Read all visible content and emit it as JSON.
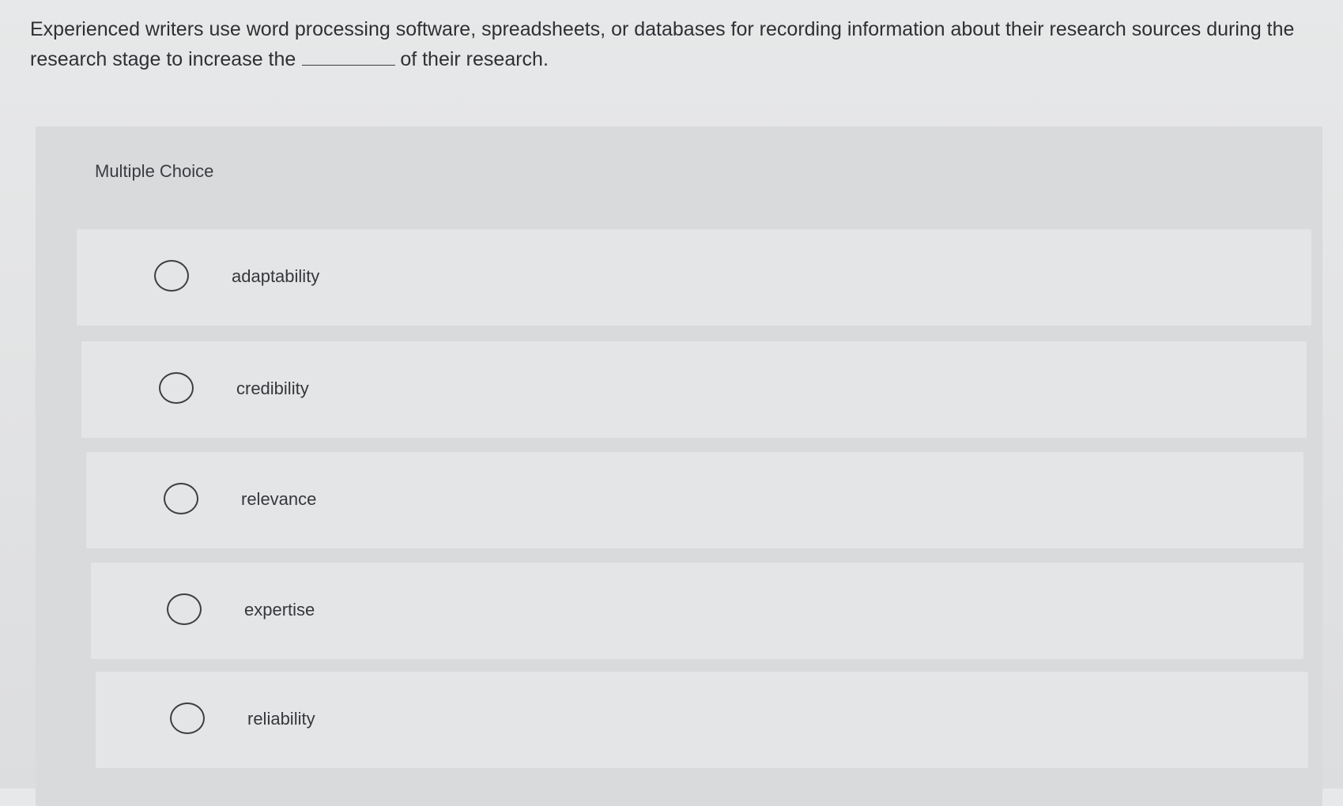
{
  "question": {
    "text_before": "Experienced writers use word processing software, spreadsheets, or databases for recording information about their research sources during the research stage to increase the",
    "text_after": "of their research."
  },
  "multiple_choice": {
    "header": "Multiple Choice",
    "options": [
      {
        "label": "adaptability",
        "selected": false
      },
      {
        "label": "credibility",
        "selected": false
      },
      {
        "label": "relevance",
        "selected": false
      },
      {
        "label": "expertise",
        "selected": false
      },
      {
        "label": "reliability",
        "selected": false
      }
    ]
  },
  "colors": {
    "page_background": "#e4e5e6",
    "panel_background": "#d9dadc",
    "option_background": "#e4e5e6",
    "text": "#2f3134"
  }
}
